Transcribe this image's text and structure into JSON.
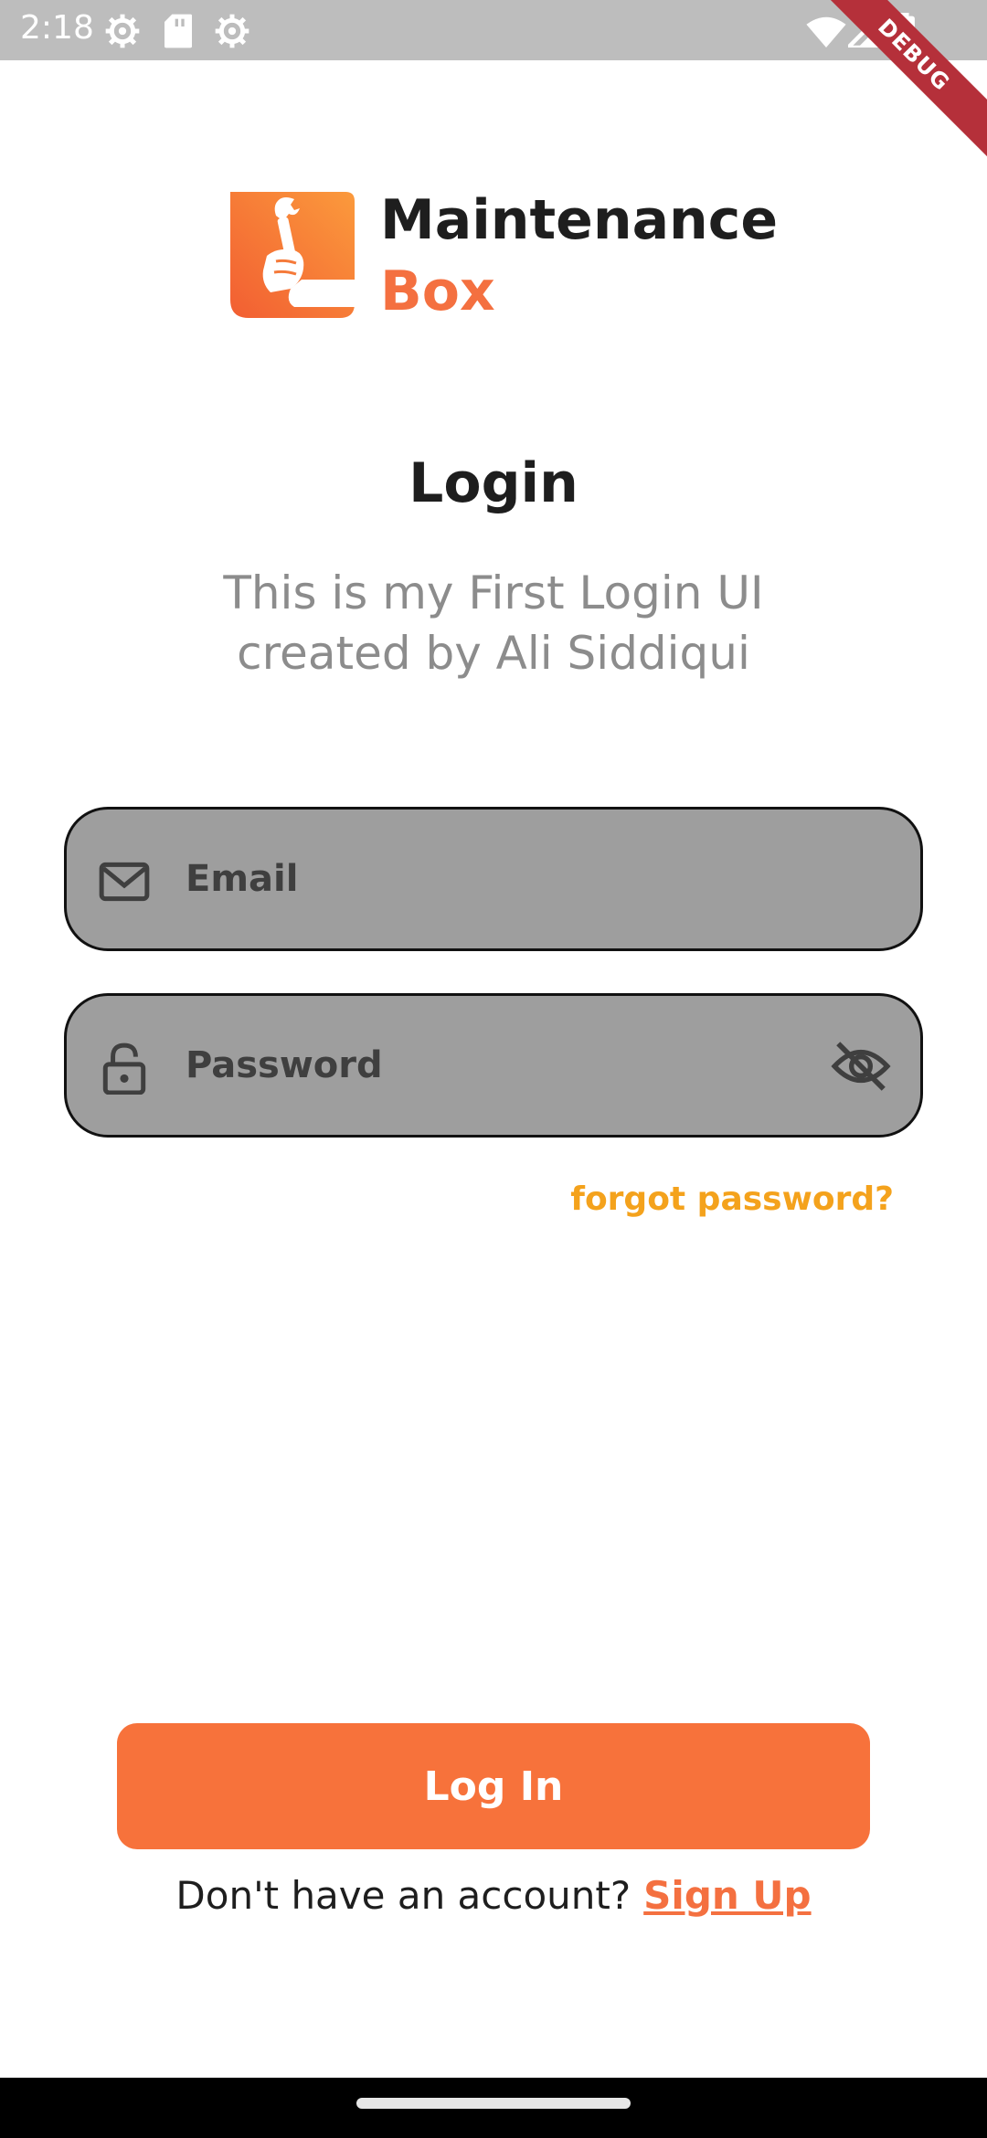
{
  "status_bar": {
    "time": "2:18",
    "icons": [
      "settings-gear-icon",
      "sd-card-icon",
      "settings-gear-icon",
      "wifi-icon",
      "signal-icon",
      "battery-icon"
    ],
    "debug_label": "DEBUG"
  },
  "logo": {
    "title": "Maintenance",
    "subtitle": "Box",
    "accent_color": "#f47040",
    "icon": "wrench-hand-icon"
  },
  "header": {
    "title": "Login",
    "subtitle": "This is my First Login UI created by Ali Siddiqui"
  },
  "form": {
    "email": {
      "placeholder": "Email",
      "value": "",
      "icon": "mail-icon"
    },
    "password": {
      "placeholder": "Password",
      "value": "",
      "icon": "lock-icon",
      "toggle_icon": "eye-off-icon"
    },
    "forgot_label": "forgot password?",
    "forgot_color": "#f4a21c"
  },
  "actions": {
    "login_label": "Log In",
    "login_color": "#f7723b",
    "no_account_text": "Don't have an account?",
    "signup_label": "Sign Up"
  }
}
